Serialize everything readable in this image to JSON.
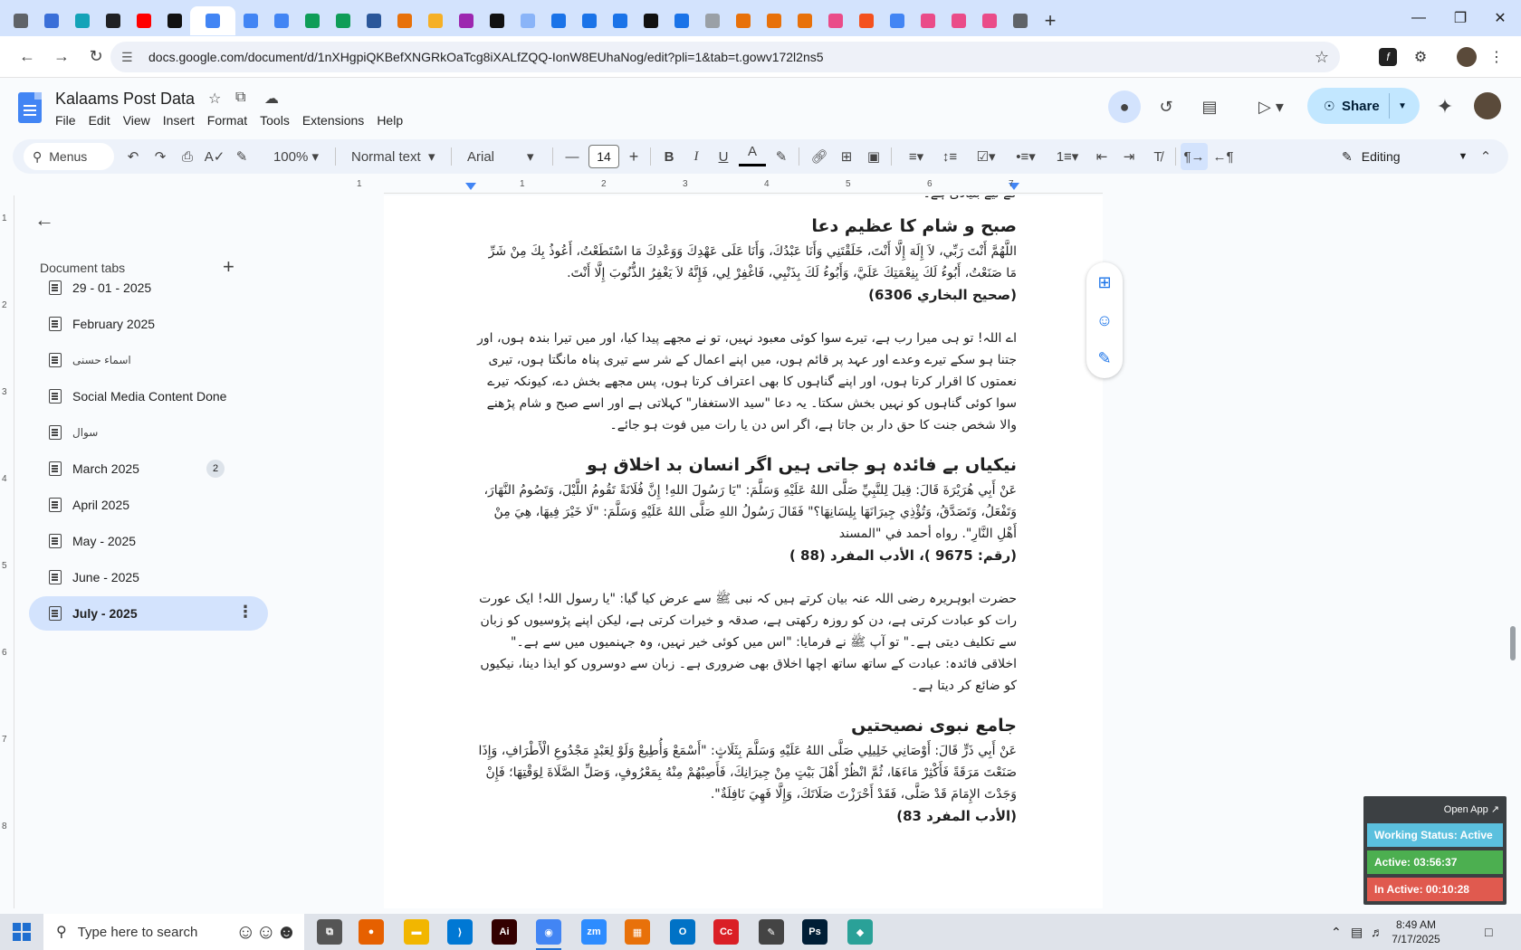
{
  "browser": {
    "tabs": [
      {
        "icon": "globe-icon",
        "color": "#5f6368"
      },
      {
        "icon": "circle-app-icon",
        "color": "#3a6fd8"
      },
      {
        "icon": "vpn-icon",
        "color": "#14a3b8"
      },
      {
        "icon": "openai-icon",
        "color": "#202124"
      },
      {
        "icon": "youtube-icon",
        "color": "#ff0000"
      },
      {
        "icon": "bolt-icon",
        "color": "#111111"
      },
      {
        "icon": "docs-icon",
        "color": "#4285f4",
        "active": true
      },
      {
        "icon": "docs-icon",
        "color": "#4285f4"
      },
      {
        "icon": "docs-icon",
        "color": "#4285f4"
      },
      {
        "icon": "sheets-icon",
        "color": "#0f9d58"
      },
      {
        "icon": "sheets-icon",
        "color": "#0f9d58"
      },
      {
        "icon": "word-icon",
        "color": "#2b579a"
      },
      {
        "icon": "grid-app-icon",
        "color": "#e8710a"
      },
      {
        "icon": "bookmark-icon",
        "color": "#f6b026"
      },
      {
        "icon": "code-icon",
        "color": "#9c27b0"
      },
      {
        "icon": "app-icon",
        "color": "#111111"
      },
      {
        "icon": "grid-app-icon",
        "color": "#8ab4f8"
      },
      {
        "icon": "docs-icon",
        "color": "#1a73e8"
      },
      {
        "icon": "docs-icon",
        "color": "#1a73e8"
      },
      {
        "icon": "docs-icon",
        "color": "#1a73e8"
      },
      {
        "icon": "medium-icon",
        "color": "#111111"
      },
      {
        "icon": "docs-icon",
        "color": "#1a73e8"
      },
      {
        "icon": "globe-icon",
        "color": "#9aa0a6"
      },
      {
        "icon": "grid-app-icon",
        "color": "#e8710a"
      },
      {
        "icon": "grid-app-icon",
        "color": "#e8710a"
      },
      {
        "icon": "grid-app-icon",
        "color": "#e8710a"
      },
      {
        "icon": "dribbble-icon",
        "color": "#ea4c89"
      },
      {
        "icon": "ring-icon",
        "color": "#f4511e"
      },
      {
        "icon": "google-icon",
        "color": "#4285f4"
      },
      {
        "icon": "dribbble-icon",
        "color": "#ea4c89"
      },
      {
        "icon": "dribbble-icon",
        "color": "#ea4c89"
      },
      {
        "icon": "dribbble-icon",
        "color": "#ea4c89"
      },
      {
        "icon": "chrome-icon",
        "color": "#5f6368"
      }
    ],
    "url": "docs.google.com/document/d/1nXHgpiQKBefXNGRkOaTcg8iXALfZQQ-IonW8EUhaNog/edit?pli=1&tab=t.gowv172l2ns5"
  },
  "doc": {
    "title": "Kalaams Post Data",
    "menus": [
      "File",
      "Edit",
      "View",
      "Insert",
      "Format",
      "Tools",
      "Extensions",
      "Help"
    ],
    "share_label": "Share"
  },
  "toolbar": {
    "menus_search": "Menus",
    "zoom": "100%",
    "style": "Normal text",
    "font": "Arial",
    "font_size": "14",
    "editing": "Editing"
  },
  "ruler": {
    "numbers": [
      "1",
      "1",
      "2",
      "3",
      "4",
      "5",
      "6",
      "7"
    ],
    "vnumbers": [
      "1",
      "2",
      "3",
      "4",
      "5",
      "6",
      "7",
      "8"
    ]
  },
  "sidebar": {
    "heading": "Document tabs",
    "tabs": [
      {
        "label": "29 - 01 - 2025"
      },
      {
        "label": "February 2025"
      },
      {
        "label": "اسماء حسنی",
        "small": true
      },
      {
        "label": "Social Media Content Done"
      },
      {
        "label": "سوال",
        "small": true
      },
      {
        "label": "March 2025",
        "badge": "2"
      },
      {
        "label": "April 2025"
      },
      {
        "label": "May - 2025"
      },
      {
        "label": "June - 2025"
      },
      {
        "label": "July - 2025",
        "selected": true
      }
    ]
  },
  "content": {
    "cut_top": "کے لیے بنیادی ہے۔",
    "s1_heading": "صبح و شام کا عظیم دعا",
    "s1_arabic": "اللَّهُمَّ أَنْتَ رَبِّي، لاَ إِلَهَ إِلَّا أَنْتَ، خَلَقْتَنِي وَأَنَا عَبْدُكَ، وَأَنَا عَلَى عَهْدِكَ وَوَعْدِكَ مَا اسْتَطَعْتُ، أَعُوذُ بِكَ مِنْ شَرِّ مَا صَنَعْتُ، أَبُوءُ لَكَ بِنِعْمَتِكَ عَلَيَّ، وَأَبُوءُ لَكَ بِذَنْبِي، فَاغْفِرْ لِي، فَإِنَّهُ لاَ يَغْفِرُ الذُّنُوبَ إِلَّا أَنْتَ.",
    "s1_ref": "(صحیح البخاري 6306)",
    "s1_urdu": "اے اللہ! تو ہی میرا رب ہے، تیرے سوا کوئی معبود نہیں، تو نے مجھے پیدا کیا، اور میں تیرا بندہ ہوں، اور جتنا ہو سکے تیرے وعدے اور عہد پر قائم ہوں، میں اپنے اعمال کے شر سے تیری پناہ مانگتا ہوں، تیری نعمتوں کا اقرار کرتا ہوں، اور اپنے گناہوں کا بھی اعتراف کرتا ہوں، پس مجھے بخش دے، کیونکہ تیرے سوا کوئی گناہوں کو نہیں بخش سکتا۔ یہ دعا \"سید الاستغفار\" کہلاتی ہے اور اسے صبح و شام پڑھنے والا شخص جنت کا حق دار بن جاتا ہے، اگر اس دن یا رات میں فوت ہو جائے۔",
    "s2_heading": "نیکیاں بے فائدہ ہو جاتی ہیں اگر انسان بد اخلاق ہو",
    "s2_arabic": "عَنْ أَبِي هُرَيْرَةَ قَالَ: قِيلَ لِلنَّبِيِّ صَلَّى اللهُ عَلَيْهِ وَسَلَّمَ: \"يَا رَسُولَ اللهِ! إِنَّ فُلَانَةً تَقُومُ اللَّيْلَ، وَتَصُومُ النَّهَارَ، وَتَفْعَلُ، وَتَصَدَّقُ، وَتُؤْذِي جِيرَانَهَا بِلِسَانِهَا؟\" فَقَالَ رَسُولُ اللهِ صَلَّى اللهُ عَلَيْهِ وَسَلَّمَ: \"لَا خَيْرَ فِيهَا، هِيَ مِنْ أَهْلِ النَّارِ\". رواه أحمد في \"المسند",
    "s2_ref": "(رقم: 9675 )، الأدب المفرد (88 )",
    "s2_urdu": "حضرت ابوہریرہ رضی اللہ عنہ بیان کرتے ہیں کہ نبی ﷺ سے عرض کیا گیا: \"یا رسول اللہ! ایک عورت رات کو عبادت کرتی ہے، دن کو روزہ رکھتی ہے، صدقہ و خیرات کرتی ہے، لیکن اپنے پڑوسیوں کو زبان سے تکلیف دیتی ہے۔\" تو آپ ﷺ نے فرمایا: \"اس میں کوئی خیر نہیں، وہ جہنمیوں میں سے ہے۔\" اخلاقی فائدہ: عبادت کے ساتھ ساتھ اچھا اخلاق بھی ضروری ہے۔ زبان سے دوسروں کو ایذا دینا، نیکیوں کو ضائع کر دیتا ہے۔",
    "s3_heading": "جامع نبوی نصیحتیں",
    "s3_arabic": "عَنْ أَبِي ذَرٍّ قَالَ: أَوْصَانِي خَلِيلِي صَلَّى اللهُ عَلَيْهِ وَسَلَّمَ بِثَلَاثٍ: \"أَسْمَعْ وَأُطِيعْ وَلَوْ لِعَبْدٍ مَجْدُوعِ الْأَطْرَافِ، وَإِذَا صَنَعْتَ مَرَقَةً فَأَكْثِرْ مَاءَهَا، ثُمَّ انْظُرْ أَهْلَ بَيْتٍ مِنْ جِيرَانِكَ، فَأَصِبْهُمْ مِنْهُ بِمَعْرُوفٍ، وَصَلِّ الصَّلَاةَ لِوَقْتِهَا؛ فَإِنْ وَجَدْتَ الإِمَامَ قَدْ صَلَّى، فَقَدْ أَحْرَزْتَ صَلَاتَكَ، وَإِلَّا فَهِيَ نَافِلَةٌ\".",
    "s3_ref": "(الأدب المفرد 83)"
  },
  "status_widget": {
    "open_app": "Open App ↗",
    "working": "Working Status: Active",
    "active": "Active: 03:56:37",
    "inactive": "In Active: 00:10:28",
    "colors": {
      "working": "#5bc0de",
      "active": "#4caf50",
      "inactive": "#e05a4f"
    }
  },
  "taskbar": {
    "search_placeholder": "Type here to search",
    "time": "8:49 AM",
    "date": "7/17/2025",
    "apps": [
      {
        "name": "task-view-icon",
        "label": "⧉",
        "color": "#555555"
      },
      {
        "name": "firefox-icon",
        "label": "●",
        "color": "#e66000"
      },
      {
        "name": "file-explorer-icon",
        "label": "▬",
        "color": "#f2b600"
      },
      {
        "name": "vscode-icon",
        "label": "⟩",
        "color": "#0078d4"
      },
      {
        "name": "illustrator-icon",
        "label": "Ai",
        "color": "#330000"
      },
      {
        "name": "chrome-icon",
        "label": "◉",
        "color": "#4285f4",
        "active": true
      },
      {
        "name": "zoom-icon",
        "label": "zm",
        "color": "#2d8cff"
      },
      {
        "name": "app-grid-icon",
        "label": "▦",
        "color": "#e8710a"
      },
      {
        "name": "outlook-icon",
        "label": "O",
        "color": "#0072c6"
      },
      {
        "name": "creative-cloud-icon",
        "label": "Cc",
        "color": "#da1f26"
      },
      {
        "name": "pen-tool-icon",
        "label": "✎",
        "color": "#444444"
      },
      {
        "name": "photoshop-icon",
        "label": "Ps",
        "color": "#001e36"
      },
      {
        "name": "gem-app-icon",
        "label": "◆",
        "color": "#2aa198"
      }
    ]
  }
}
